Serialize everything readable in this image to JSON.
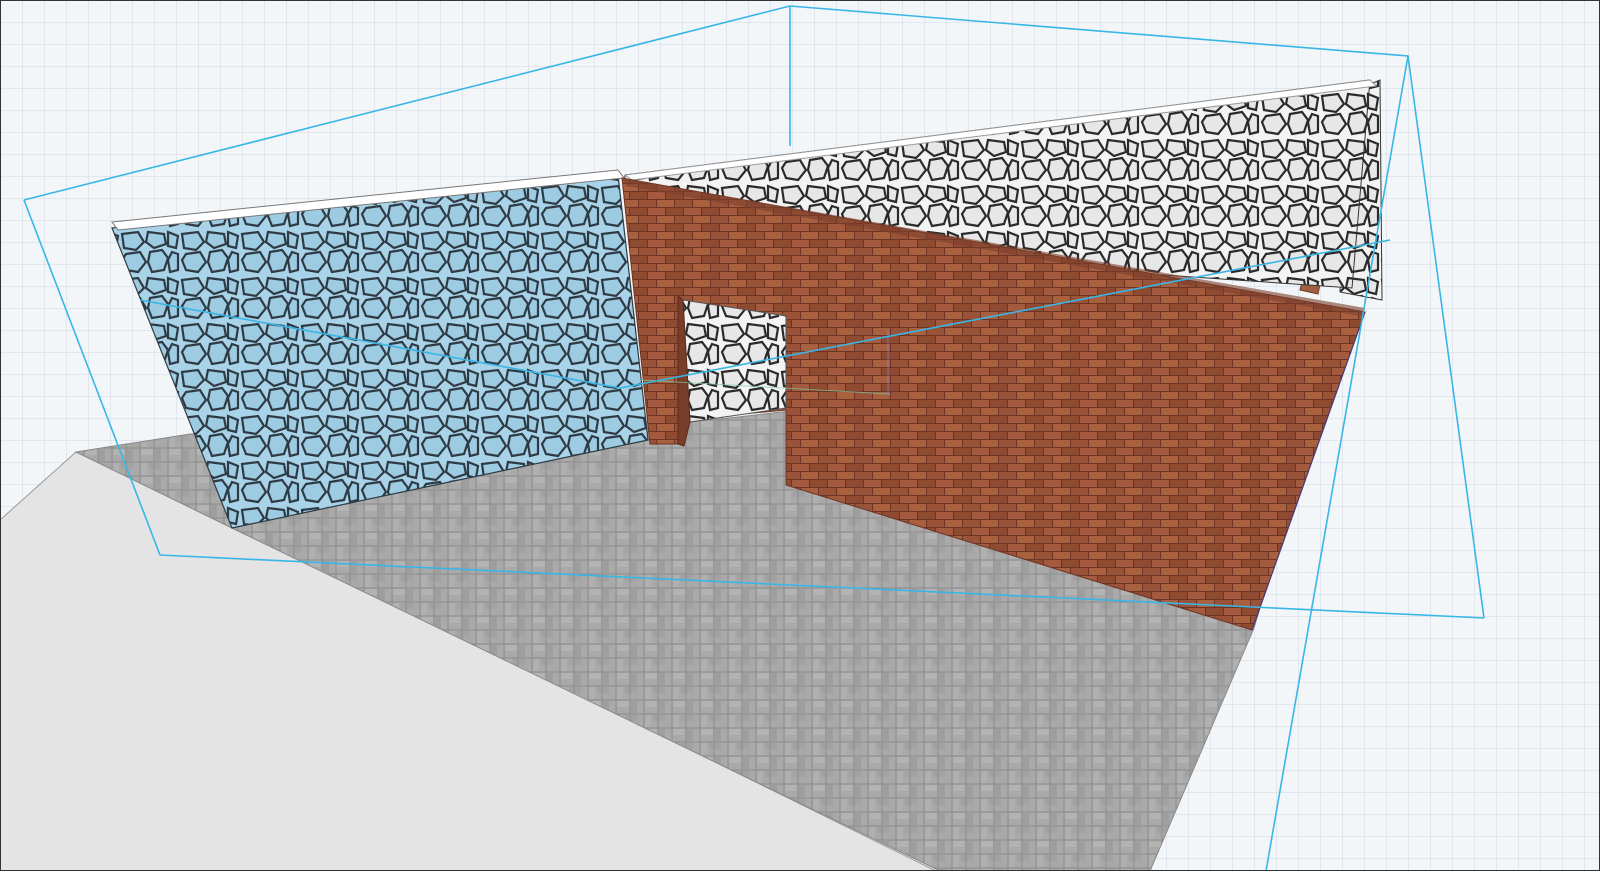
{
  "scene": {
    "background_color": "#f3f6f9",
    "grid_minor_color": "#c9d3dd",
    "grid_major_color": "#aebbc8",
    "selection_box_color": "#39b6e6",
    "walls": [
      {
        "id": "wall-left",
        "material": "flagstone",
        "base_color": "#a9d3e8",
        "line_color": "#2f3b44",
        "selected": true
      },
      {
        "id": "wall-back",
        "material": "flagstone",
        "base_color": "#f2f2f2",
        "line_color": "#2a2a2a",
        "selected": false
      },
      {
        "id": "wall-right",
        "material": "flagstone",
        "base_color": "#f2f2f2",
        "line_color": "#2a2a2a",
        "selected": false
      },
      {
        "id": "wall-front-brick",
        "material": "brick",
        "base_color": "#9a5238",
        "line_color": "#6e3423",
        "selected": false,
        "has_doorway": true
      }
    ],
    "floor": {
      "material": "paving",
      "base_color": "#a9a9a9",
      "line_color": "#8c8c8c"
    },
    "slab_edge_color": "#e4e4e4"
  }
}
